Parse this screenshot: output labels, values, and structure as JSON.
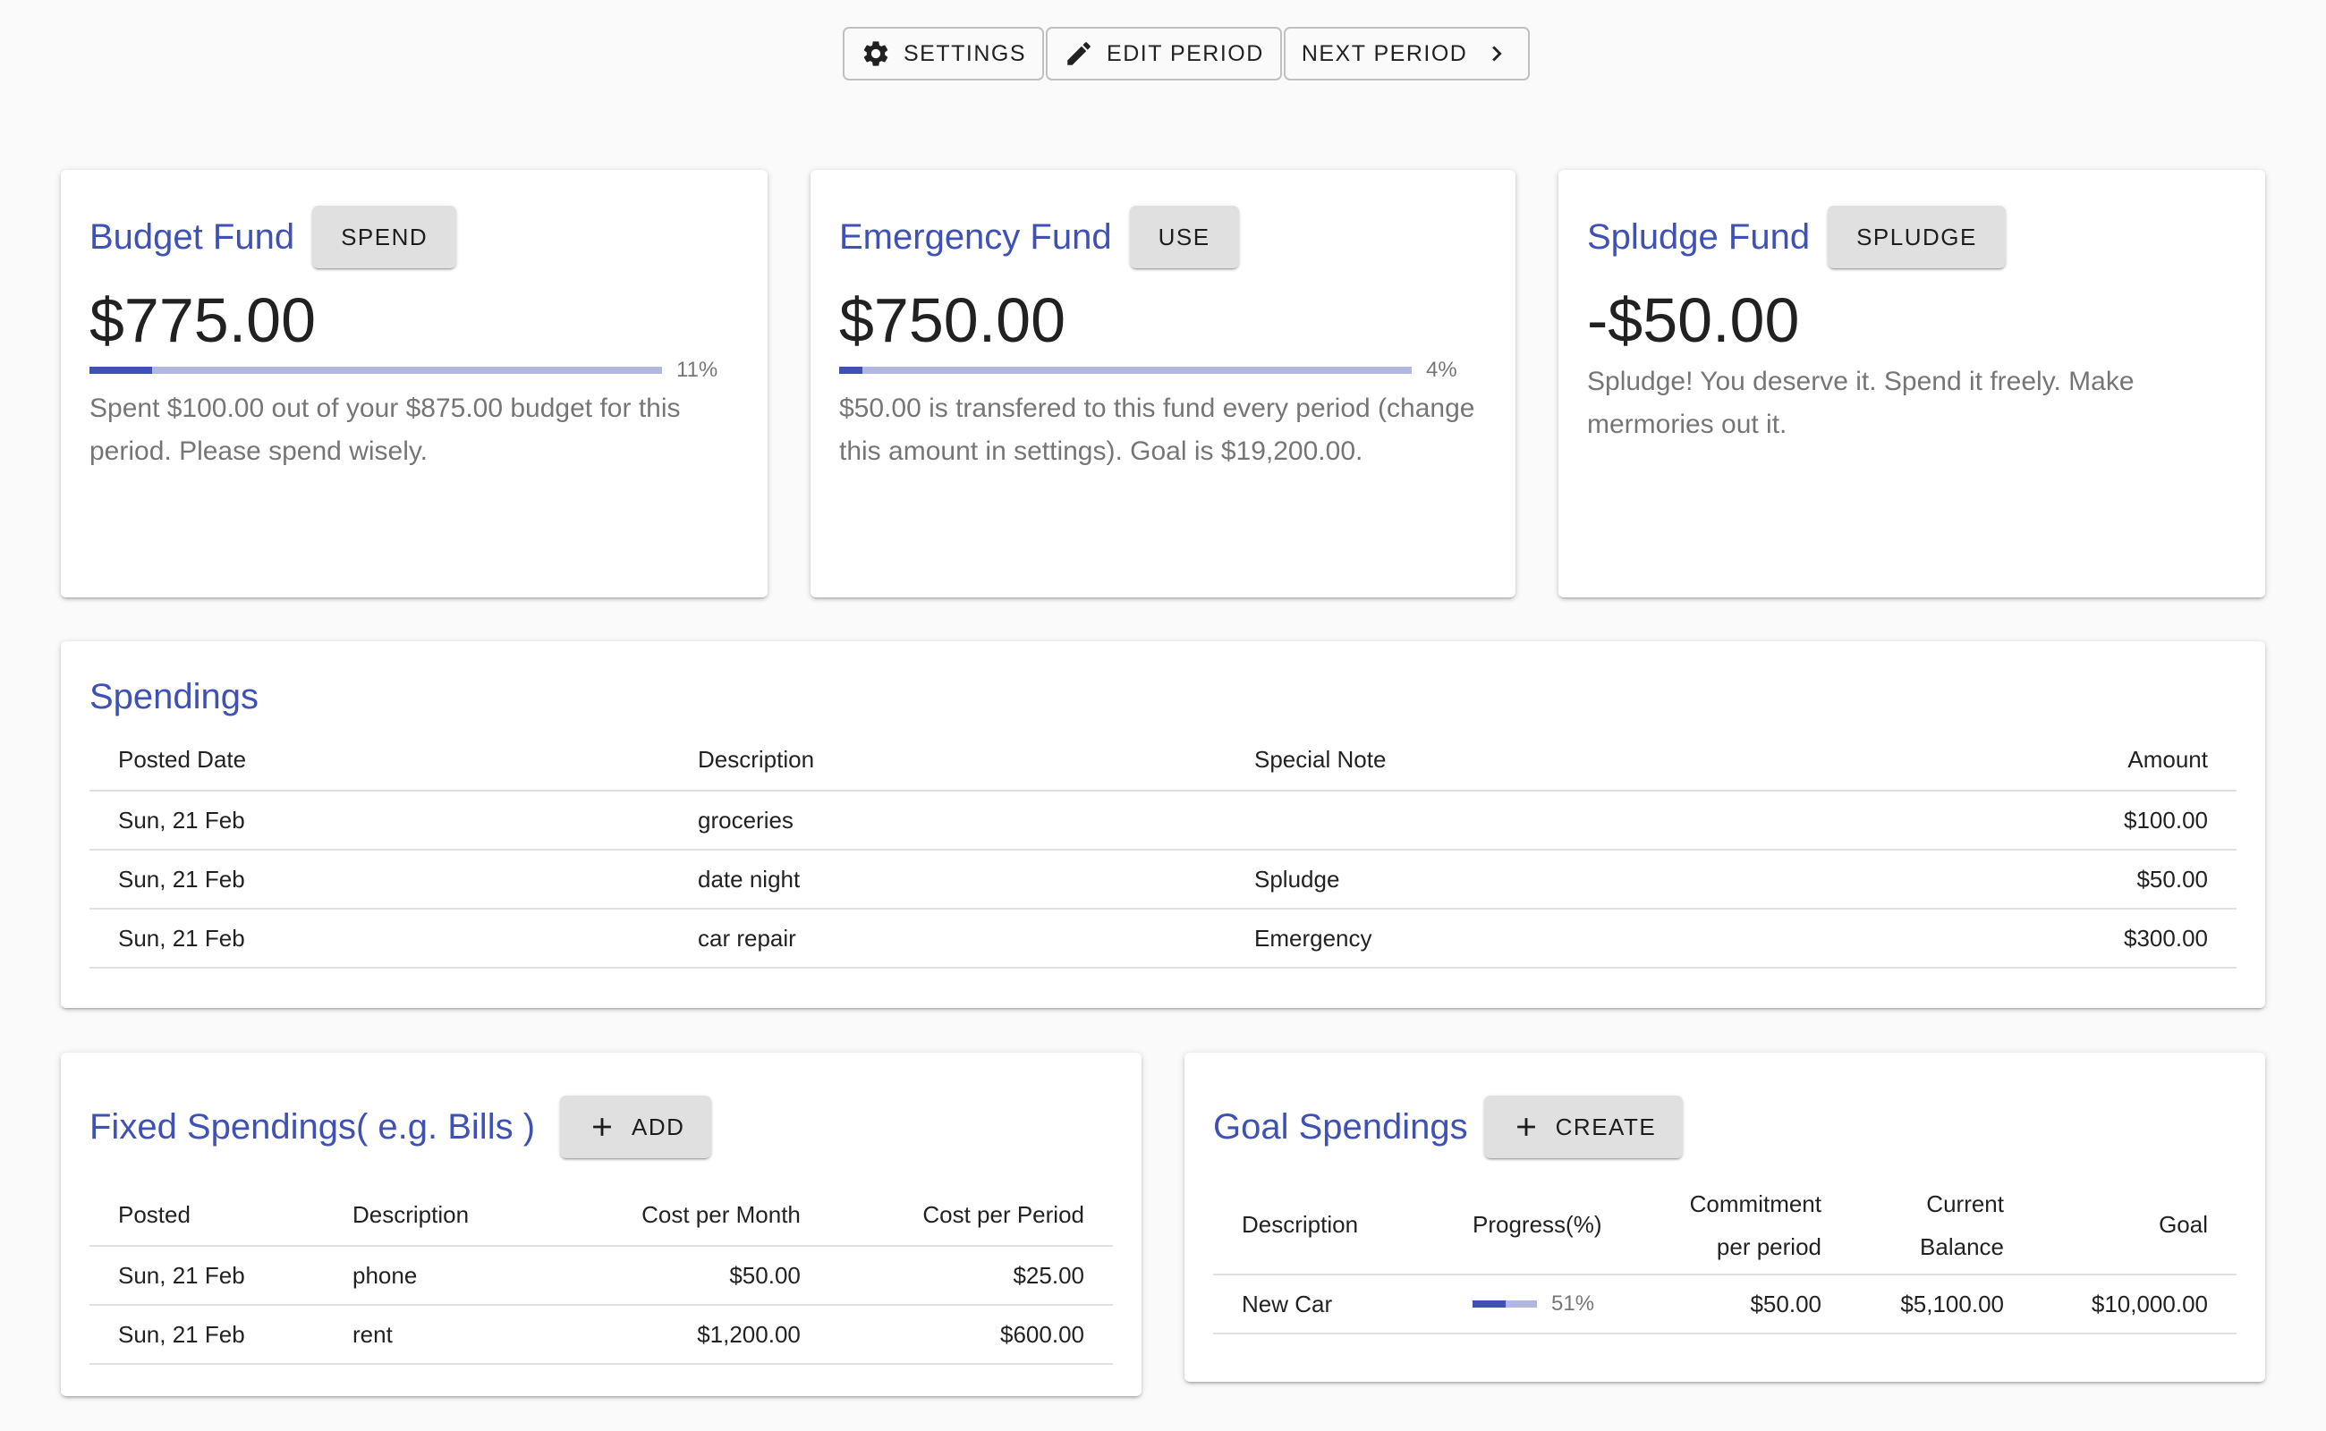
{
  "toolbar": {
    "settings_label": "SETTINGS",
    "edit_period_label": "EDIT PERIOD",
    "next_period_label": "NEXT PERIOD"
  },
  "funds": {
    "budget": {
      "title": "Budget Fund",
      "button": "SPEND",
      "amount": "$775.00",
      "progress_percent": 11,
      "progress_label": "11%",
      "text": "Spent $100.00 out of your $875.00 budget for this period. Please spend wisely."
    },
    "emergency": {
      "title": "Emergency Fund",
      "button": "USE",
      "amount": "$750.00",
      "progress_percent": 4,
      "progress_label": "4%",
      "text": "$50.00 is transfered to this fund every period (change this amount in settings). Goal is $19,200.00."
    },
    "splurge": {
      "title": "Spludge Fund",
      "button": "SPLUDGE",
      "amount": "-$50.00",
      "text": "Spludge! You deserve it. Spend it freely. Make mermories out it."
    }
  },
  "spendings": {
    "title": "Spendings",
    "headers": [
      "Posted Date",
      "Description",
      "Special Note",
      "Amount"
    ],
    "rows": [
      [
        "Sun, 21 Feb",
        "groceries",
        "",
        "$100.00"
      ],
      [
        "Sun, 21 Feb",
        "date night",
        "Spludge",
        "$50.00"
      ],
      [
        "Sun, 21 Feb",
        "car repair",
        "Emergency",
        "$300.00"
      ]
    ]
  },
  "fixed": {
    "title": "Fixed Spendings( e.g. Bills )",
    "button": "ADD",
    "headers": [
      "Posted",
      "Description",
      "Cost per Month",
      "Cost per Period"
    ],
    "rows": [
      [
        "Sun, 21 Feb",
        "phone",
        "$50.00",
        "$25.00"
      ],
      [
        "Sun, 21 Feb",
        "rent",
        "$1,200.00",
        "$600.00"
      ]
    ]
  },
  "goals": {
    "title": "Goal Spendings",
    "button": "CREATE",
    "headers": [
      "Description",
      "Progress(%)",
      "Commitment per period",
      "Current Balance",
      "Goal"
    ],
    "rows": [
      {
        "description": "New Car",
        "progress_percent": 51,
        "progress_label": "51%",
        "commitment": "$50.00",
        "balance": "$5,100.00",
        "goal": "$10,000.00"
      }
    ]
  },
  "colors": {
    "accent": "#3f51b5",
    "progress_track": "#b0b7e0",
    "background": "#fafafa"
  }
}
